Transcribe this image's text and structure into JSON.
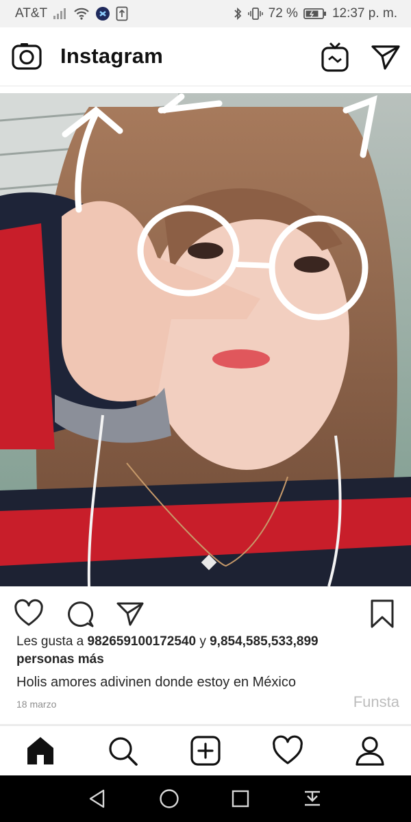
{
  "status_bar": {
    "carrier": "AT&T",
    "battery_percent": "72 %",
    "time": "12:37 p. m.",
    "icons": [
      "signal-icon",
      "wifi-icon",
      "notification-icon",
      "upload-icon",
      "bluetooth-icon",
      "vibrate-icon",
      "battery-icon"
    ]
  },
  "header": {
    "title": "Instagram",
    "icons": [
      "camera-icon",
      "igtv-icon",
      "direct-message-icon"
    ]
  },
  "post": {
    "image_description_icon": "selfie-photo",
    "actions": [
      "like-icon",
      "comment-icon",
      "share-icon",
      "bookmark-icon"
    ],
    "likes_prefix": "Les gusta a ",
    "likes_user": "982659100172540",
    "likes_connector": " y ",
    "likes_count": "9,854,585,533,899",
    "likes_suffix": "personas más",
    "caption": "Holis amores adivinen donde estoy en México",
    "date": "18 marzo",
    "watermark": "Funsta"
  },
  "tab_bar": {
    "items": [
      "home-icon",
      "search-icon",
      "new-post-icon",
      "activity-icon",
      "profile-icon"
    ]
  },
  "android_nav": {
    "items": [
      "back-icon",
      "home-circle-icon",
      "recents-icon",
      "notification-pull-icon"
    ]
  },
  "colors": {
    "accent_text": "#262626",
    "muted": "#8e8e8e",
    "statusbar_bg": "#f2f2f2"
  }
}
